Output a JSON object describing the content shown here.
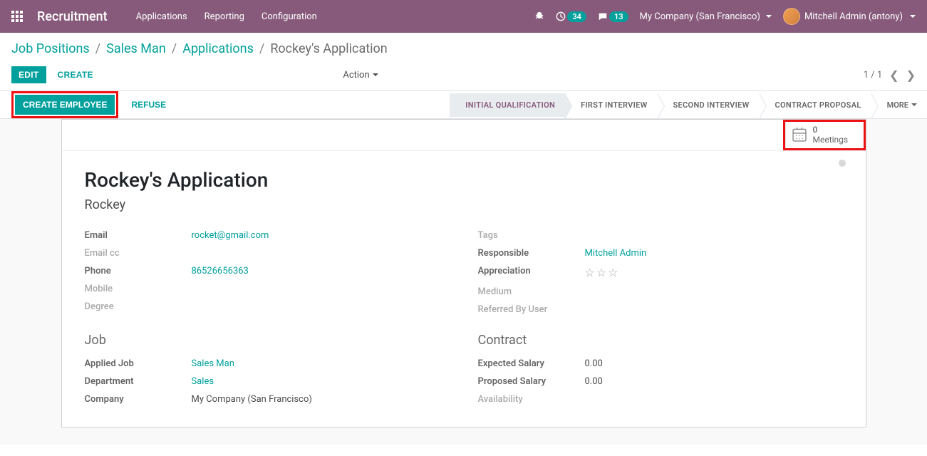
{
  "navbar": {
    "brand": "Recruitment",
    "menu": [
      "Applications",
      "Reporting",
      "Configuration"
    ],
    "activities_count": "34",
    "messages_count": "13",
    "company": "My Company (San Francisco)",
    "user": "Mitchell Admin (antony)"
  },
  "breadcrumb": {
    "items": [
      "Job Positions",
      "Sales Man",
      "Applications"
    ],
    "current": "Rockey's Application"
  },
  "toolbar": {
    "edit": "Edit",
    "create": "Create",
    "action": "Action"
  },
  "pager": {
    "text": "1 / 1"
  },
  "statusbar": {
    "create_employee": "Create Employee",
    "refuse": "Refuse",
    "stages": [
      "Initial Qualification",
      "First Interview",
      "Second Interview",
      "Contract Proposal"
    ],
    "more": "More"
  },
  "buttonbox": {
    "meetings_count": "0",
    "meetings_label": "Meetings"
  },
  "record": {
    "title": "Rockey's Application",
    "partner_name": "Rockey",
    "labels": {
      "email": "Email",
      "email_cc": "Email cc",
      "phone": "Phone",
      "mobile": "Mobile",
      "degree": "Degree",
      "tags": "Tags",
      "responsible": "Responsible",
      "appreciation": "Appreciation",
      "medium": "Medium",
      "referred_by": "Referred By User",
      "job": "Job",
      "applied_job": "Applied Job",
      "department": "Department",
      "company": "Company",
      "contract": "Contract",
      "expected_salary": "Expected Salary",
      "proposed_salary": "Proposed Salary",
      "availability": "Availability"
    },
    "email": "rocket@gmail.com",
    "phone": "86526656363",
    "responsible": "Mitchell Admin",
    "applied_job": "Sales Man",
    "department": "Sales",
    "company_value": "My Company (San Francisco)",
    "expected_salary": "0.00",
    "proposed_salary": "0.00"
  }
}
